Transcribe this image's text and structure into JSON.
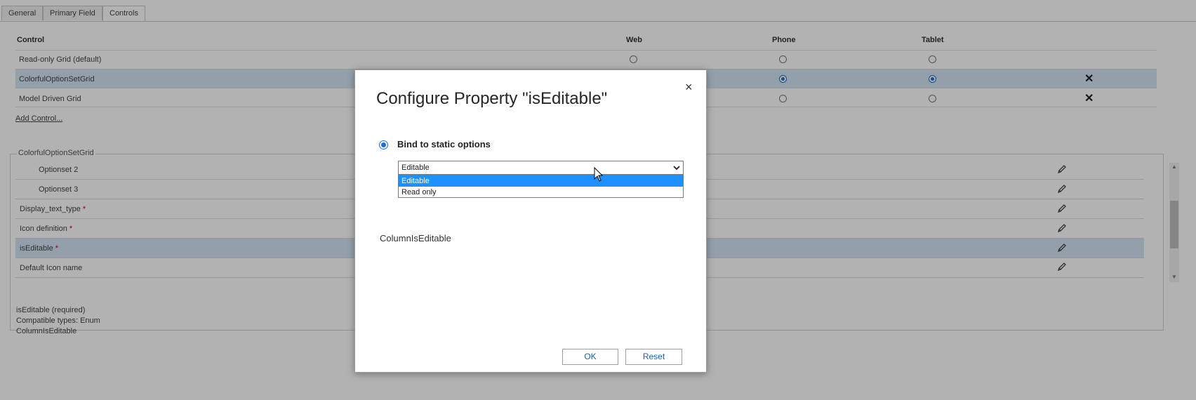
{
  "tabs": [
    "General",
    "Primary Field",
    "Controls"
  ],
  "controls_table": {
    "headers": {
      "control": "Control",
      "web": "Web",
      "phone": "Phone",
      "tablet": "Tablet"
    },
    "rows": [
      {
        "label": "Read-only Grid (default)",
        "web": false,
        "phone": false,
        "tablet": false,
        "removable": false
      },
      {
        "label": "ColorfulOptionSetGrid",
        "web": null,
        "phone": true,
        "tablet": true,
        "removable": true
      },
      {
        "label": "Model Driven Grid",
        "web": null,
        "phone": false,
        "tablet": false,
        "removable": true
      }
    ],
    "add_control_link": "Add Control..."
  },
  "properties": {
    "legend": "ColorfulOptionSetGrid",
    "rows": [
      {
        "label": "Optionset 2",
        "required": false
      },
      {
        "label": "Optionset 3",
        "required": false
      },
      {
        "label": "Display_text_type",
        "required": true
      },
      {
        "label": "Icon definition",
        "required": true
      },
      {
        "label": "isEditable",
        "required": true
      },
      {
        "label": "Default Icon name",
        "required": false
      }
    ],
    "required_marker": "*"
  },
  "info": {
    "line1": "isEditable (required)",
    "line2": "Compatible types: Enum",
    "line3": "ColumnIsEditable"
  },
  "dialog": {
    "title": "Configure Property \"isEditable\"",
    "close_glyph": "×",
    "radio_label": "Bind to static options",
    "select_value": "Editable",
    "options": [
      "Editable",
      "Read only"
    ],
    "column_value": "ColumnIsEditable",
    "ok_label": "OK",
    "reset_label": "Reset"
  },
  "colors": {
    "selected_row": "#d3e6f5",
    "accent": "#1a6fd0",
    "dropdown_highlight": "#1e90ff"
  }
}
